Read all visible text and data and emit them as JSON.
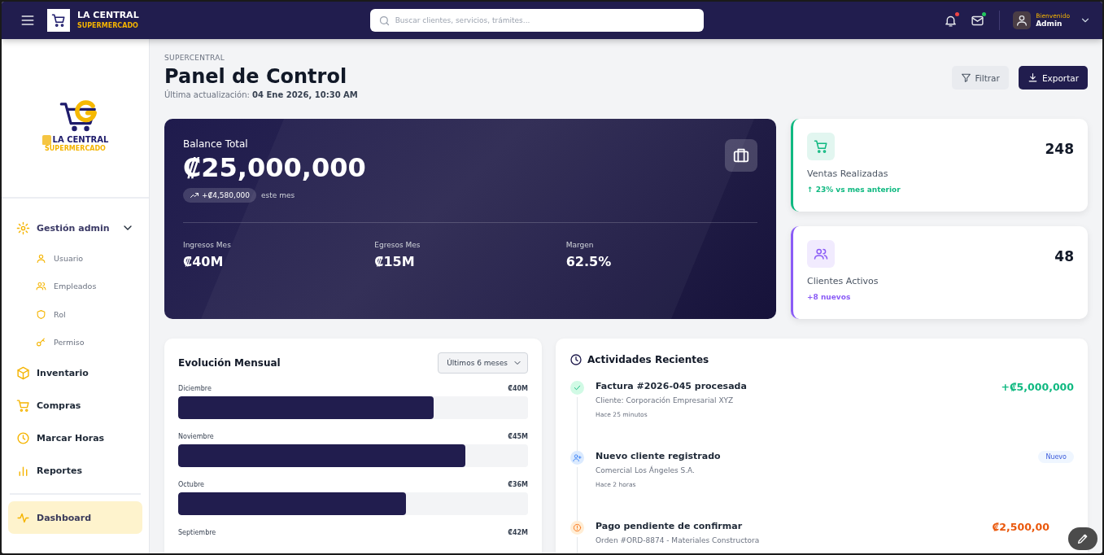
{
  "topbar": {
    "brand": "LA CENTRAL",
    "brand_sub": "SUPERMERCADO",
    "search": {
      "placeholder": "Buscar clientes, servicios, trámites..."
    },
    "notifications": {
      "unread": true
    },
    "messages": {
      "unread": true
    },
    "user": {
      "greeting": "Bienvenido",
      "name": "Admin"
    }
  },
  "sidebar": {
    "logo": {
      "name": "LA CENTRAL",
      "sub": "SUPERMERCADO"
    },
    "items": [
      {
        "label": "Gestión admin",
        "selected": false,
        "expanded": true,
        "children": [
          {
            "label": "Usuario"
          },
          {
            "label": "Empleados"
          },
          {
            "label": "Rol"
          },
          {
            "label": "Permiso"
          }
        ]
      },
      {
        "label": "Inventario",
        "selected": false
      },
      {
        "label": "Compras",
        "selected": false
      },
      {
        "label": "Marcar Horas",
        "selected": false
      },
      {
        "label": "Reportes",
        "selected": false
      },
      {
        "label": "Dashboard",
        "selected": true
      }
    ]
  },
  "header": {
    "breadcrumb": "SUPERCENTRAL",
    "title": "Panel de Control",
    "updated_label": "Última actualización:",
    "updated_value": "04 Ene 2026, 10:30 AM",
    "buttons": [
      {
        "label": "Filtrar",
        "kind": "secondary"
      },
      {
        "label": "Exportar",
        "kind": "primary"
      }
    ]
  },
  "balance": {
    "label": "Balance Total",
    "amount": "₡25,000,000",
    "change": "+₡4,580,000",
    "change_note": "este mes",
    "stats": [
      {
        "label": "Ingresos Mes",
        "value": "₡40M"
      },
      {
        "label": "Egresos Mes",
        "value": "₡15M"
      },
      {
        "label": "Margen",
        "value": "62.5%"
      }
    ]
  },
  "stat_cards": [
    {
      "kind": "sales",
      "label": "Ventas Realizadas",
      "value": "248",
      "note": "↑ 23% vs mes anterior",
      "color": "#10b981"
    },
    {
      "kind": "clients",
      "label": "Clientes Activos",
      "value": "48",
      "note": "+8 nuevos",
      "color": "#8b5cf6"
    }
  ],
  "monthly": {
    "title": "Evolución Mensual",
    "period": "Últimos 6 meses",
    "rows": [
      {
        "month": "Diciembre",
        "value": "₡40M",
        "level": 0.73
      },
      {
        "month": "Noviembre",
        "value": "₡45M",
        "level": 0.82
      },
      {
        "month": "Octubre",
        "value": "₡36M",
        "level": 0.65
      },
      {
        "month": "Septiembre",
        "value": "₡42M"
      }
    ]
  },
  "activities": {
    "title": "Actividades Recientes",
    "items": [
      {
        "kind": "success",
        "title": "Factura #2026-045 procesada",
        "detail": "Cliente: Corporación Empresarial XYZ",
        "time": "Hace 25 minutos",
        "amount": "+₡5,000,000"
      },
      {
        "kind": "info",
        "title": "Nuevo cliente registrado",
        "detail": "Comercial Los Ángeles S.A.",
        "time": "Hace 2 horas",
        "badge": "Nuevo"
      },
      {
        "kind": "warning",
        "title": "Pago pendiente de confirmar",
        "detail": "Orden #ORD-8874 - Materiales Constructora",
        "amount": "₡2,500,00"
      }
    ]
  }
}
